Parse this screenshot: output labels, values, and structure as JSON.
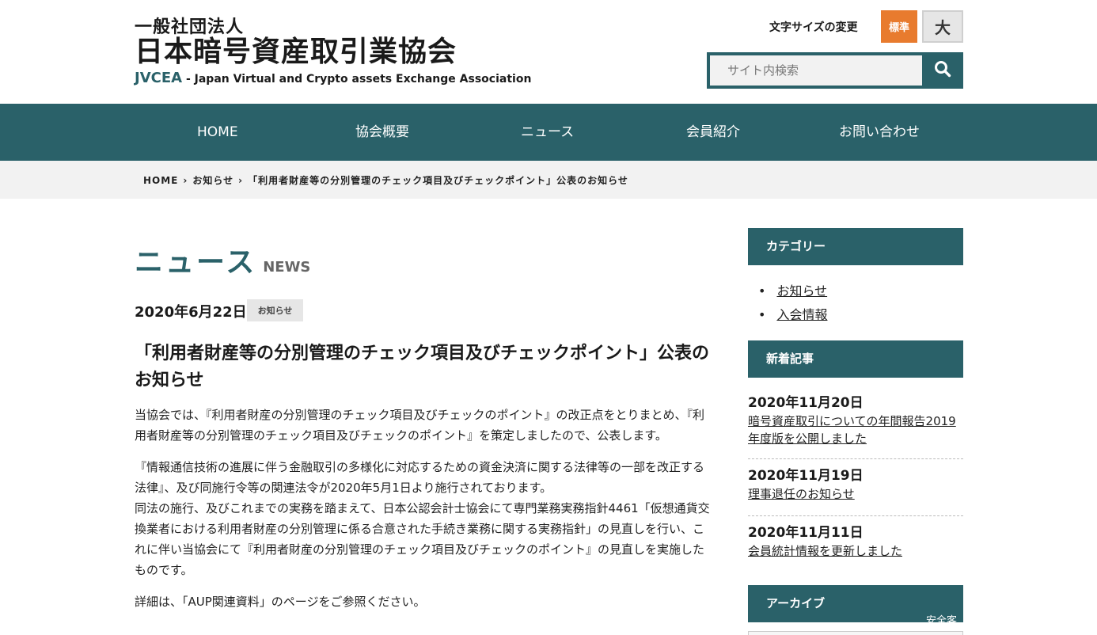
{
  "header": {
    "logo_line1": "一般社団法人",
    "logo_line2": "日本暗号資産取引業協会",
    "logo_acronym": "JVCEA",
    "logo_english": " - Japan Virtual and Crypto assets Exchange Association",
    "fontsize_label": "文字サイズの変更",
    "fontsize_standard": "標準",
    "fontsize_large": "大",
    "search_placeholder": "サイト内検索"
  },
  "nav": {
    "items": [
      "HOME",
      "協会概要",
      "ニュース",
      "会員紹介",
      "お問い合わせ"
    ]
  },
  "breadcrumb": {
    "home": "HOME",
    "sep": "›",
    "category": "お知らせ",
    "current": "「利用者財産等の分別管理のチェック項目及びチェックポイント」公表のお知らせ"
  },
  "main": {
    "section_title": "ニュース",
    "section_title_en": "NEWS",
    "date": "2020年6月22日",
    "tag": "お知らせ",
    "title": "「利用者財産等の分別管理のチェック項目及びチェックポイント」公表のお知らせ",
    "paragraphs": [
      "当協会では、『利用者財産の分別管理のチェック項目及びチェックのポイント』の改正点をとりまとめ、『利用者財産等の分別管理のチェック項目及びチェックのポイント』を策定しましたので、公表します。",
      "『情報通信技術の進展に伴う金融取引の多様化に対応するための資金決済に関する法律等の一部を改正する法律』、及び同施行令等の関連法令が2020年5月1日より施行されております。",
      "同法の施行、及びこれまでの実務を踏まえて、日本公認会計士協会にて専門業務実務指針4461「仮想通貨交換業者における利用者財産の分別管理に係る合意された手続き業務に関する実務指針」の見直しを行い、これに伴い当協会にて『利用者財産の分別管理のチェック項目及びチェックのポイント』の見直しを実施したものです。",
      "詳細は、「AUP関連資料」のページをご参照ください。"
    ]
  },
  "sidebar": {
    "category_heading": "カテゴリー",
    "categories": [
      "お知らせ",
      "入会情報"
    ],
    "recent_heading": "新着記事",
    "recent": [
      {
        "date": "2020年11月20日",
        "title": "暗号資産取引についての年間報告2019年度版を公開しました"
      },
      {
        "date": "2020年11月19日",
        "title": "理事退任のお知らせ"
      },
      {
        "date": "2020年11月11日",
        "title": "会員統計情報を更新しました"
      }
    ],
    "archive_heading": "アーカイブ",
    "security_label": "安全客"
  },
  "colors": {
    "brand_teal": "#2a6169",
    "accent_orange": "#e87b2e"
  }
}
